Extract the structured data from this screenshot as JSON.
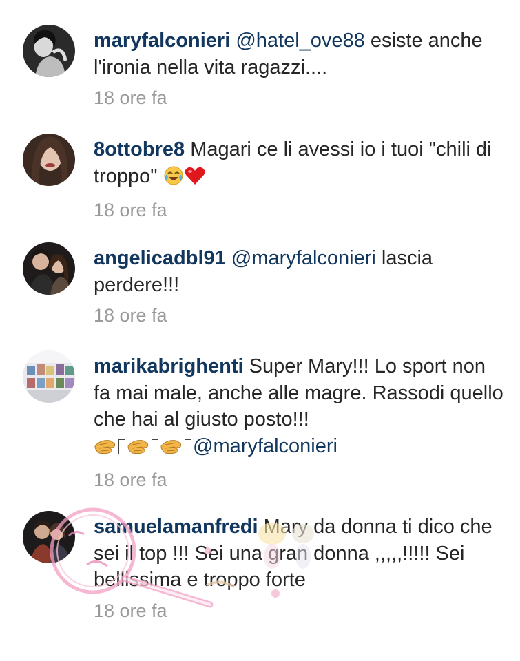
{
  "comments": [
    {
      "username": "maryfalconieri",
      "mention": "@hatel_ove88",
      "text": " esiste anche l'ironia nella vita ragazzi....",
      "time": "18 ore fa",
      "avatar_icon": "woman-bw-portrait"
    },
    {
      "username": "8ottobre8",
      "text": " Magari ce li avessi io i tuoi \"chili di troppo\" ",
      "emojis": [
        "face-with-tears-of-joy",
        "red-heart"
      ],
      "time": "18 ore fa",
      "avatar_icon": "woman-long-hair-portrait"
    },
    {
      "username": "angelicadbl91",
      "mention": "@maryfalconieri",
      "text": " lascia perdere!!!",
      "time": "18 ore fa",
      "avatar_icon": "couple-portrait"
    },
    {
      "username": "marikabrighenti",
      "text": " Super Mary!!! Lo sport non fa mai male, anche alle magre. Rassodi quello che hai al giusto posto!!!",
      "emojis": [
        "clapping-hands",
        "clapping-hands",
        "clapping-hands"
      ],
      "mention": "@maryfalconieri",
      "time": "18 ore fa",
      "avatar_icon": "photo-wall"
    },
    {
      "username": "samuelamanfredi",
      "text": " Mary da donna ti dico che sei il top !!! Sei una gran donna ,,,,,!!!!! Sei bellissima e troppo forte",
      "time": "18 ore fa",
      "avatar_icon": "couple-dark-portrait"
    }
  ],
  "colors": {
    "username": "#12375e",
    "text": "#262626",
    "time": "#9a9a9a"
  }
}
